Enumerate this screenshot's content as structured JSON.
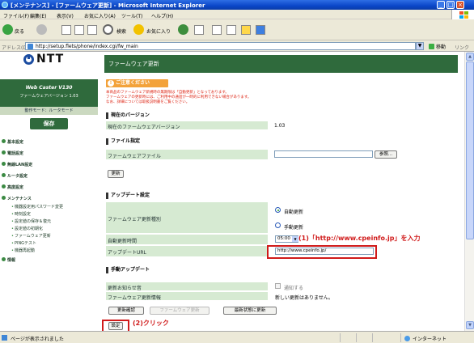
{
  "window": {
    "title": "[メンテナンス] - [ファームウェア更新] - Microsoft Internet Explorer",
    "min": "_",
    "max": "□",
    "close": "×"
  },
  "menu": [
    "ファイル(F)",
    "編集(E)",
    "表示(V)",
    "お気に入り(A)",
    "ツール(T)",
    "ヘルプ(H)"
  ],
  "toolbar": {
    "back": "戻る",
    "search": "検索",
    "favorites": "お気に入り"
  },
  "address": {
    "label": "アドレス(D)",
    "url": "http://setup.flets/phone/index.cgi/fw_main",
    "go": "移動",
    "links": "リンク"
  },
  "sidebar": {
    "logo": "NTT",
    "product": "Web Caster V130",
    "fw_version_label": "ファームウェアバージョン 1.03",
    "mode": "動作モード：ルータモード",
    "save": "保存",
    "items": [
      {
        "label": "基本設定",
        "sub": false
      },
      {
        "label": "電話設定",
        "sub": false
      },
      {
        "label": "無線LAN設定",
        "sub": false
      },
      {
        "label": "ルータ設定",
        "sub": false
      },
      {
        "label": "高度設定",
        "sub": false
      },
      {
        "label": "メンテナンス",
        "sub": false
      },
      {
        "label": "機器設定用パスワード変更",
        "sub": true
      },
      {
        "label": "時刻設定",
        "sub": true
      },
      {
        "label": "設定値の保存＆復元",
        "sub": true
      },
      {
        "label": "設定値の初期化",
        "sub": true
      },
      {
        "label": "ファームウェア更新",
        "sub": true
      },
      {
        "label": "PINGテスト",
        "sub": true
      },
      {
        "label": "機器再起動",
        "sub": true
      },
      {
        "label": "情報",
        "sub": false
      }
    ]
  },
  "main": {
    "header": "ファームウェア更新",
    "caution_title": "ご注意ください",
    "warnings": [
      "本商品のファームウェア新規時の無期限は「自動更新」となっております。",
      "ファームウェアの更新時には、ご利用中の通話が一時的に利用できない場合があります。",
      "なお、詳細については取扱説明書をご覧ください。"
    ],
    "current_version_section": "現在のバージョン",
    "current_version_label": "現在のファームウェアバージョン",
    "current_version_value": "1.03",
    "file_section": "ファイル指定",
    "file_label": "ファームウェアファイル",
    "browse": "参照...",
    "update": "更新",
    "update_settings_section": "アップデート設定",
    "update_type_label": "ファームウェア更新種別",
    "auto_update": "自動更新",
    "manual_update": "手動更新",
    "auto_time_label": "自動更新時間",
    "auto_time_value": "05:00",
    "update_url_label": "アップデートURL",
    "update_url_value": "http://www.cpeinfo.jp/",
    "manual_section": "手動アップデート",
    "notify_label": "更新お知らせ音",
    "notify_value": "通知する",
    "info_label": "ファームウェア更新情報",
    "info_value": "新しい更新はありません。",
    "check_btn": "更新確認",
    "fw_update_btn": "ファームウェア更新",
    "refresh_btn": "最新状態に更新",
    "set_btn": "設定"
  },
  "annotations": {
    "step1": "(1)「http://www.cpeinfo.jp」を入力",
    "step2": "(2)クリック"
  },
  "status": {
    "text": "ページが表示されました",
    "zone": "インターネット"
  }
}
